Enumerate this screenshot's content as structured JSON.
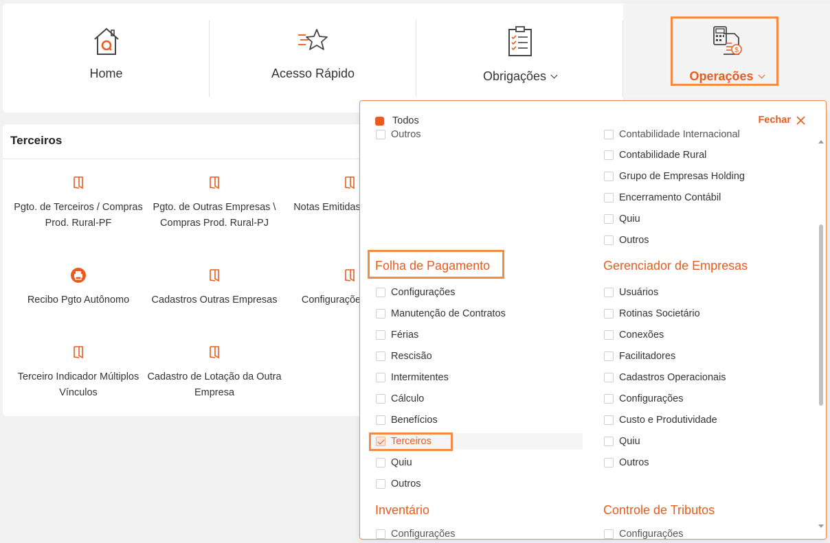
{
  "nav": {
    "home": "Home",
    "acesso": "Acesso Rápido",
    "obrigacoes": "Obrigações",
    "operacoes": "Operações"
  },
  "panel": {
    "title": "Terceiros",
    "tiles": [
      "Pgto. de Terceiros / Compras Prod. Rural-PF",
      "Pgto. de Outras Empresas \\ Compras Prod. Rural-PJ",
      "Notas Emitidas Produção",
      "Recibo Pgto Autônomo",
      "Cadastros Outras Empresas",
      "Configuraçõe Empres",
      "Terceiro Indicador Múltiplos Vínculos",
      "Cadastro de Lotação da Outra Empresa"
    ]
  },
  "dropdown": {
    "todos": "Todos",
    "close": "Fechar",
    "left_top_cut": "Outros",
    "right_top_cut": "Contabilidade Internacional",
    "right_top": [
      "Contabilidade Rural",
      "Grupo de Empresas Holding",
      "Encerramento Contábil",
      "Quiu",
      "Outros"
    ],
    "folha": {
      "title": "Folha de Pagamento",
      "items": [
        "Configurações",
        "Manutenção de Contratos",
        "Férias",
        "Rescisão",
        "Intermitentes",
        "Cálculo",
        "Benefícios",
        "Terceiros",
        "Quiu",
        "Outros"
      ]
    },
    "gerenciador": {
      "title": "Gerenciador de Empresas",
      "items": [
        "Usuários",
        "Rotinas Societário",
        "Conexões",
        "Facilitadores",
        "Cadastros Operacionais",
        "Configurações",
        "Custo e Produtividade",
        "Quiu",
        "Outros"
      ]
    },
    "inventario": {
      "title": "Inventário",
      "first_cut": "Configurações"
    },
    "controle": {
      "title": "Controle de Tributos",
      "first_cut": "Configurações"
    }
  },
  "colors": {
    "accent": "#ea5b1f",
    "highlight": "#f58a45"
  }
}
